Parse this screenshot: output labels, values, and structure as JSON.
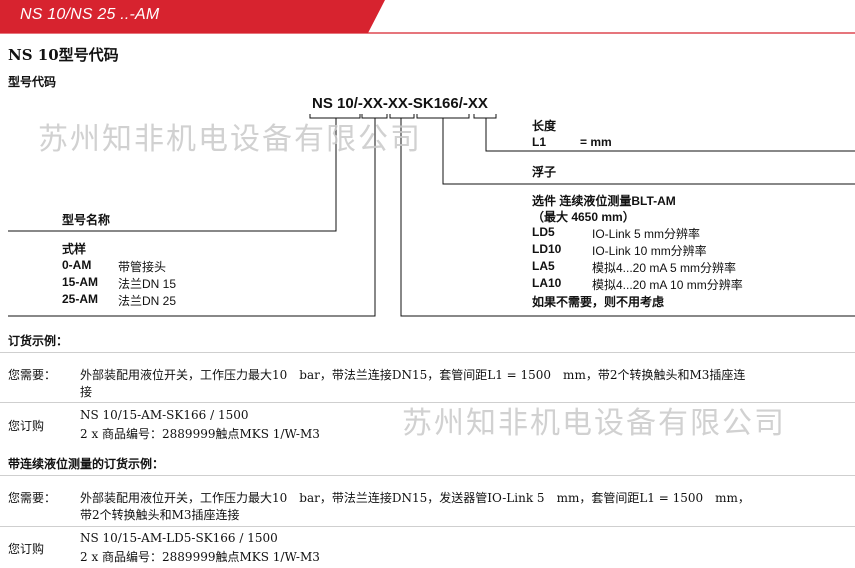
{
  "header": {
    "title": "NS 10/NS 25 ..-AM",
    "bar_color": "#d7232f"
  },
  "section": {
    "title": "NS 10型号代码",
    "subtitle": "型号代码"
  },
  "code": {
    "full": "NS 10/-XX-XX-SK166/-XX"
  },
  "length": {
    "title": "长度",
    "key": "L1",
    "value": "= mm"
  },
  "float_title": "浮子",
  "option": {
    "title": "选件 连续液位测量BLT-AM",
    "max": "（最大 4650 mm）",
    "items": [
      {
        "code": "LD5",
        "desc": "IO-Link 5 mm分辨率"
      },
      {
        "code": "LD10",
        "desc": "IO-Link 10 mm分辨率"
      },
      {
        "code": "LA5",
        "desc": "模拟4...20 mA 5 mm分辨率"
      },
      {
        "code": "LA10",
        "desc": "模拟4...20 mA 10 mm分辨率"
      }
    ],
    "note": "如果不需要，则不用考虑"
  },
  "model_name": "型号名称",
  "style": {
    "title": "式样",
    "items": [
      {
        "code": "0-AM",
        "desc": "带管接头"
      },
      {
        "code": "15-AM",
        "desc": "法兰DN 15"
      },
      {
        "code": "25-AM",
        "desc": "法兰DN 25"
      }
    ]
  },
  "watermark": "苏州知非机电设备有限公司",
  "order1": {
    "title": "订货示例：",
    "need_label": "您需要：",
    "need_line1": "外部装配用液位开关，工作压力最大10　bar，带法兰连接DN15，套管间距L1 = 1500　mm，带2个转换触头和M3插座连",
    "need_line2": "接",
    "order_label": "您订购",
    "order_line1": "NS 10/15-AM-SK166 / 1500",
    "order_line2": "2 x 商品编号：2889999触点MKS 1/W-M3"
  },
  "order2": {
    "title": "带连续液位测量的订货示例：",
    "need_label": "您需要：",
    "need_line1": "外部装配用液位开关，工作压力最大10　bar，带法兰连接DN15，发送器管IO-Link 5　mm，套管间距L1 = 1500　mm，",
    "need_line2": "带2个转换触头和M3插座连接",
    "order_label": "您订购",
    "order_line1": "NS 10/15-AM-LD5-SK166 / 1500",
    "order_line2": "2 x 商品编号：2889999触点MKS 1/W-M3"
  }
}
